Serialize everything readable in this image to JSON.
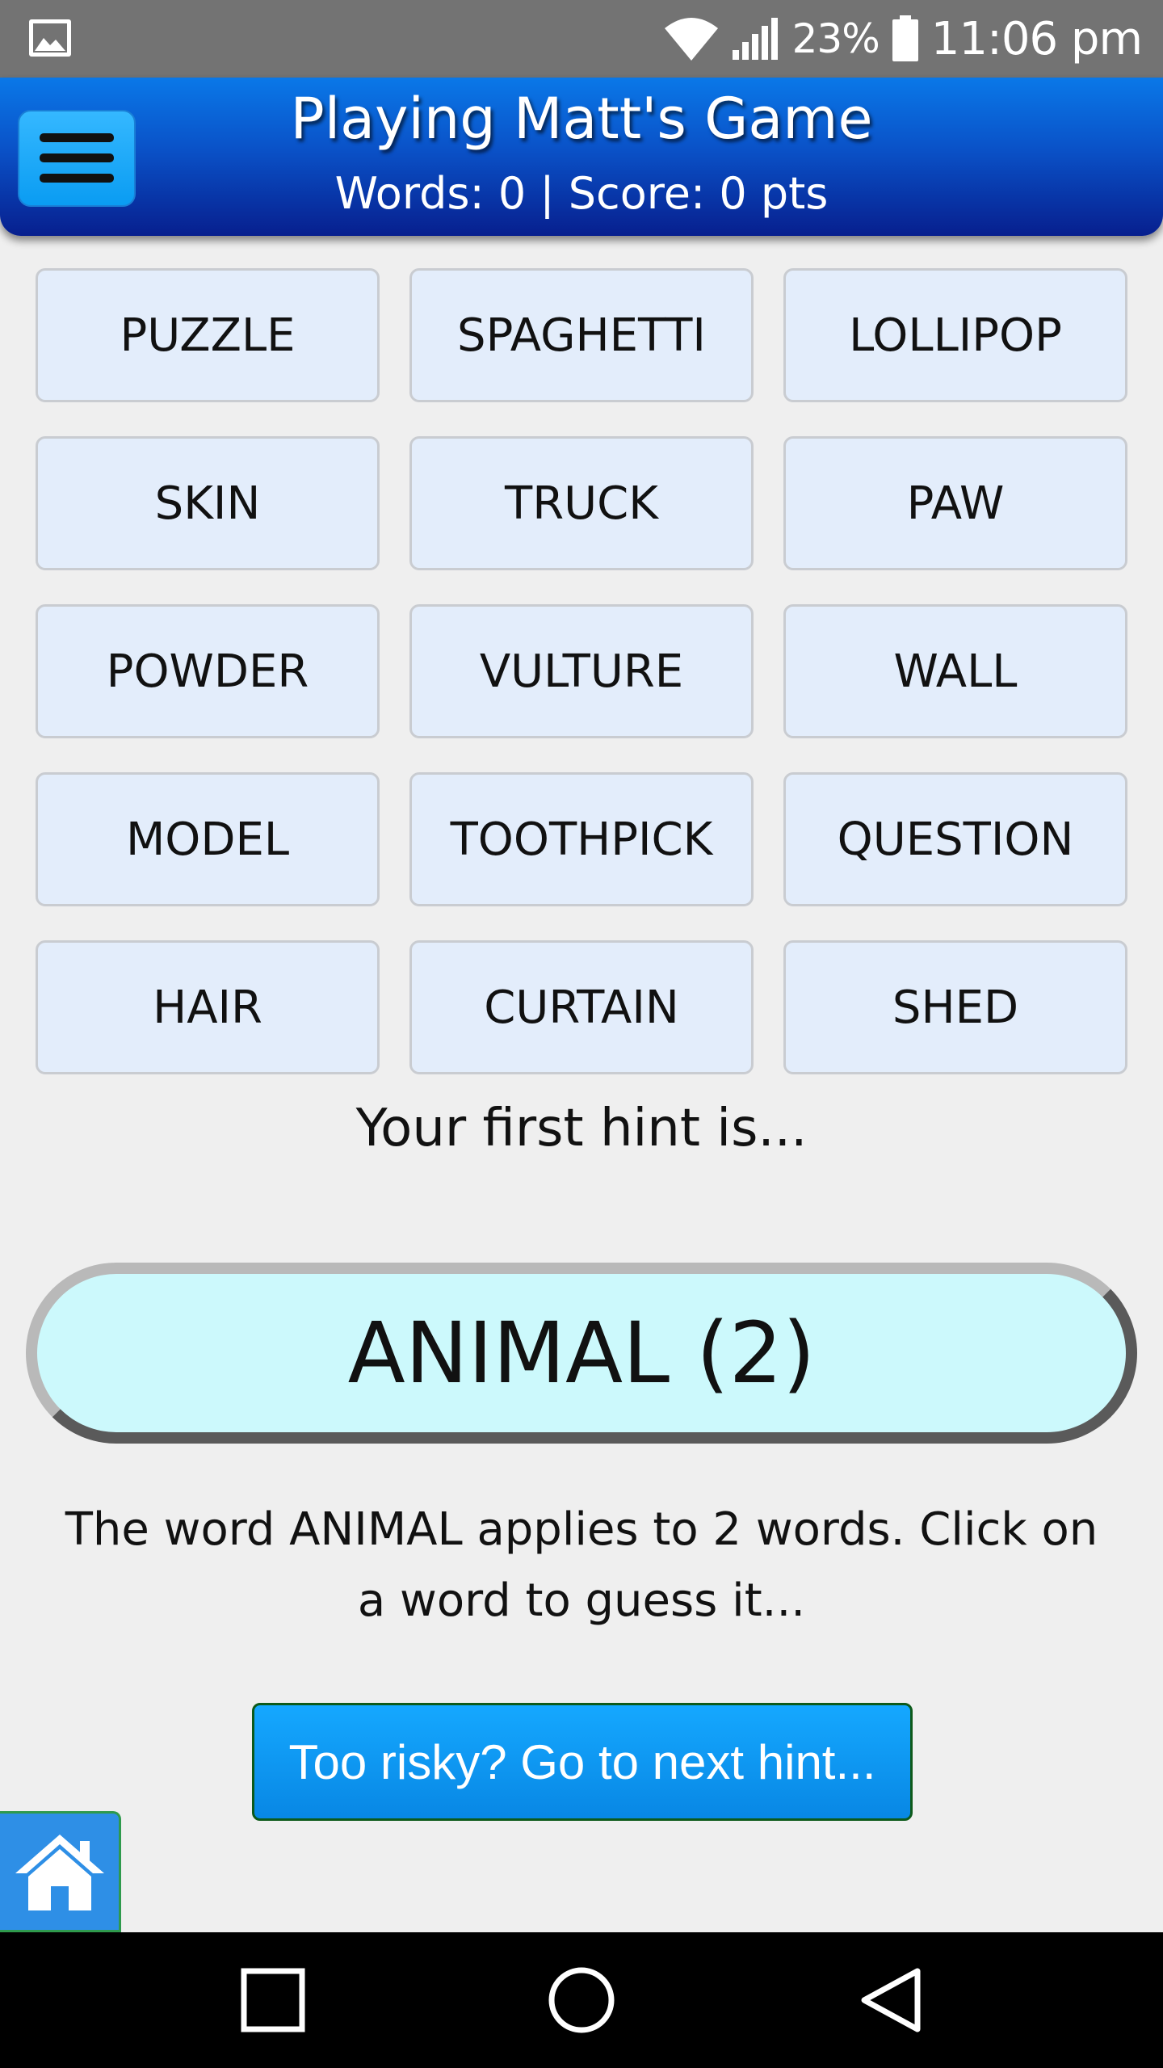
{
  "status_bar": {
    "battery_percent": "23%",
    "time": "11:06 pm",
    "icons": [
      "image-icon",
      "wifi-icon",
      "signal-icon",
      "battery-icon"
    ]
  },
  "header": {
    "title": "Playing Matt's Game",
    "stats": "Words: 0 | Score: 0 pts",
    "menu_icon": "hamburger-menu-icon"
  },
  "words": [
    {
      "label": "PUZZLE"
    },
    {
      "label": "SPAGHETTI"
    },
    {
      "label": "LOLLIPOP"
    },
    {
      "label": "SKIN"
    },
    {
      "label": "TRUCK"
    },
    {
      "label": "PAW"
    },
    {
      "label": "POWDER"
    },
    {
      "label": "VULTURE"
    },
    {
      "label": "WALL"
    },
    {
      "label": "MODEL"
    },
    {
      "label": "TOOTHPICK"
    },
    {
      "label": "QUESTION"
    },
    {
      "label": "HAIR"
    },
    {
      "label": "CURTAIN"
    },
    {
      "label": "SHED"
    }
  ],
  "hint": {
    "intro": "Your first hint is...",
    "label": "ANIMAL (2)",
    "description": "The word ANIMAL applies to 2 words. Click on a word to guess it..."
  },
  "actions": {
    "next_hint_label": "Too risky? Go to next hint...",
    "home_icon": "home-icon"
  },
  "nav_bar": {
    "icons": [
      "recent-apps-icon",
      "home-circle-icon",
      "back-icon"
    ]
  },
  "colors": {
    "header_top": "#0a78e8",
    "header_bottom": "#071f8e",
    "word_button_bg": "#e3edfb",
    "hint_pill_bg": "#ccf9fc",
    "next_hint_button_bg": "#0a9cf2"
  }
}
